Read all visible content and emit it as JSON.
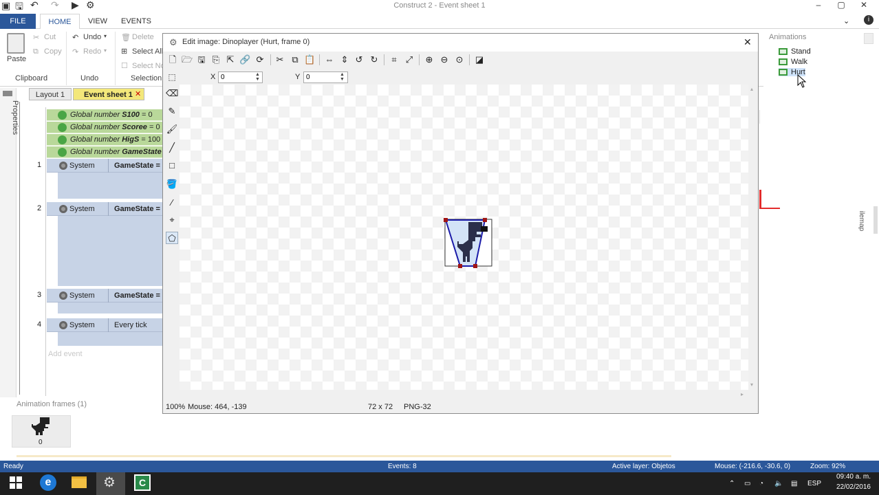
{
  "window": {
    "title": "Construct 2 - Event sheet 1"
  },
  "ribbon": {
    "tabs": [
      "FILE",
      "HOME",
      "VIEW",
      "EVENTS"
    ],
    "clipboard": {
      "paste": "Paste",
      "cut": "Cut",
      "copy": "Copy",
      "group": "Clipboard"
    },
    "undo": {
      "undo": "Undo",
      "redo": "Redo",
      "group": "Undo"
    },
    "selection": {
      "delete": "Delete",
      "select_all": "Select All",
      "select_none": "Select No",
      "group": "Selection"
    }
  },
  "leftdock": {
    "label": "Properties"
  },
  "doctabs": {
    "layout": "Layout 1",
    "eventsheet": "Event sheet 1",
    "close": "✕"
  },
  "events": {
    "globals": [
      {
        "prefix": "Global number",
        "name": "S100",
        "value": "= 0"
      },
      {
        "prefix": "Global number",
        "name": "Scoree",
        "value": "= 0"
      },
      {
        "prefix": "Global number",
        "name": "HigS",
        "value": "= 100"
      },
      {
        "prefix": "Global number",
        "name": "GameState",
        "value": ""
      }
    ],
    "rows": [
      {
        "num": "1",
        "object": "System",
        "condition": "GameState ="
      },
      {
        "num": "2",
        "object": "System",
        "condition": "GameState ="
      },
      {
        "num": "3",
        "object": "System",
        "condition": "GameState ="
      },
      {
        "num": "4",
        "object": "System",
        "condition": "Every tick"
      }
    ],
    "add_event": "Add event"
  },
  "animframes": {
    "label": "Animation frames (1)",
    "frame_index": "0"
  },
  "dialog": {
    "title": "Edit image: Dinoplayer (Hurt, frame 0)",
    "close": "✕",
    "x_label": "X",
    "x_value": "0",
    "y_label": "Y",
    "y_value": "0",
    "status_zoom": "100%",
    "status_mouse": "Mouse: 464, -139",
    "status_size": "72 x 72",
    "status_format": "PNG-32"
  },
  "animations": {
    "label": "Animations",
    "items": [
      "Stand",
      "Walk",
      "Hurt"
    ],
    "side_label": "ilemap"
  },
  "statusbar": {
    "ready": "Ready",
    "events": "Events: 8",
    "layer": "Active layer: Objetos",
    "mouse": "Mouse: (-216.6, -30.6, 0)",
    "zoom": "Zoom: 92%"
  },
  "taskbar": {
    "lang": "ESP",
    "time": "09:40 a. m.",
    "date": "22/02/2016"
  },
  "colors": {
    "accent": "#2b579a",
    "event_bg": "#c7d3e6",
    "global_bg": "#b9d89a",
    "taskbar": "#1f1f1f"
  }
}
